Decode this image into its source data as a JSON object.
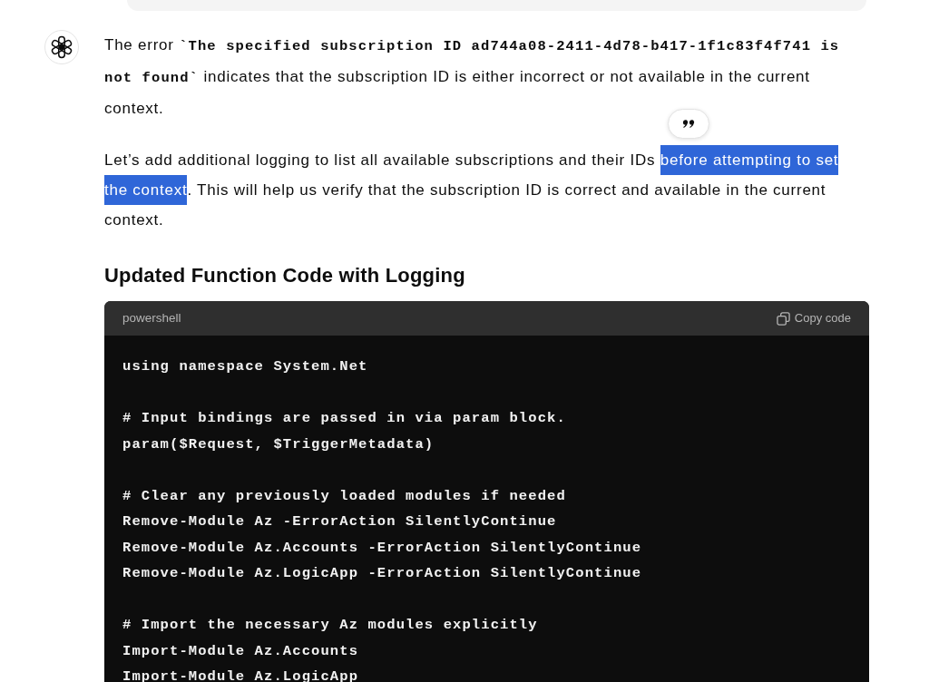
{
  "assistant_message": {
    "paragraphs": [
      {
        "segments": [
          {
            "kind": "text",
            "text": "The error ",
            "selected": false
          },
          {
            "kind": "code",
            "text": "`The specified subscription ID ad744a08-2411-4d78-b417-1f1c83f4f741 is not found`",
            "selected": false
          },
          {
            "kind": "text",
            "text": " indicates that the subscription ID is either incorrect or not available in the current context.",
            "selected": false
          }
        ]
      },
      {
        "segments": [
          {
            "kind": "text",
            "text": "Let’s add additional logging to list all available subscriptions and their IDs ",
            "selected": false
          },
          {
            "kind": "text",
            "text": "before attempting to set the context",
            "selected": true
          },
          {
            "kind": "text",
            "text": ". This will help us verify that the subscription ID is correct and available in the current context.",
            "selected": false
          }
        ]
      }
    ],
    "heading": "Updated Function Code with Logging",
    "code_block": {
      "language": "powershell",
      "copy_label": "Copy code",
      "code": "using namespace System.Net\n\n# Input bindings are passed in via param block.\nparam($Request, $TriggerMetadata)\n\n# Clear any previously loaded modules if needed\nRemove-Module Az -ErrorAction SilentlyContinue\nRemove-Module Az.Accounts -ErrorAction SilentlyContinue\nRemove-Module Az.LogicApp -ErrorAction SilentlyContinue\n\n# Import the necessary Az modules explicitly\nImport-Module Az.Accounts\nImport-Module Az.LogicApp"
    }
  }
}
